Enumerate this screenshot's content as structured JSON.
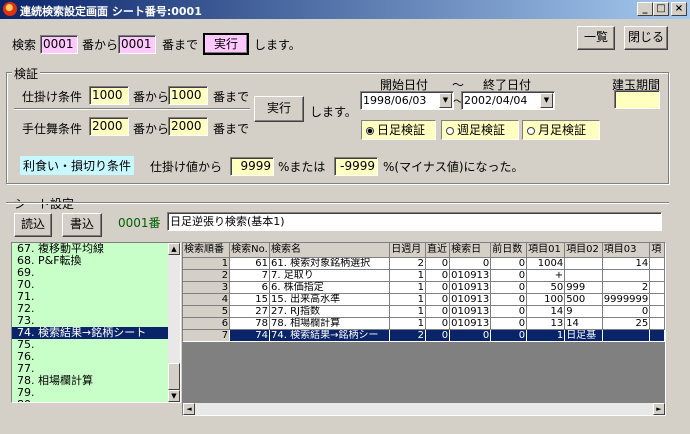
{
  "window": {
    "title": "連続検索設定画面 シート番号:0001",
    "minimize": "_",
    "maximize": "□",
    "close": "×"
  },
  "top": {
    "search_label": "検索",
    "from_value": "0001",
    "from_suffix": "番から",
    "to_value": "0001",
    "to_suffix": "番まで",
    "run": "実行",
    "tail": "します。",
    "list_button": "一覧",
    "close_button": "閉じる"
  },
  "verify": {
    "title": "検証",
    "cond1_label": "仕掛け条件",
    "cond1_from": "1000",
    "cond1_mid": "番から",
    "cond1_to": "1000",
    "cond1_end": "番まで",
    "cond2_label": "手仕舞条件",
    "cond2_from": "2000",
    "cond2_mid": "番から",
    "cond2_to": "2000",
    "cond2_end": "番まで",
    "run": "実行",
    "tail": "します。",
    "start_label": "開始日付",
    "tilde": "～",
    "end_label": "終了日付",
    "start_date": "1998/06/03",
    "end_date": "2002/04/04",
    "period_label": "建玉期間",
    "period_value": "",
    "radio_daily": "日足検証",
    "radio_weekly": "週足検証",
    "radio_monthly": "月足検証",
    "profit_label": "利食い・損切り条件",
    "profit_text1": "仕掛け値から",
    "profit_value": "9999",
    "profit_text2": "%または",
    "loss_value": "-9999",
    "profit_text3": "%(マイナス値)になった。"
  },
  "sheet": {
    "title": "シート設定",
    "load": "読込",
    "write": "書込",
    "number": "0001番",
    "name": "日足逆張り検索(基本1)",
    "list": [
      "67. 複移動平均線",
      "68. P&F転換",
      "69.",
      "70.",
      "71.",
      "72.",
      "73.",
      "74. 検索結果→銘柄シート",
      "75.",
      "76.",
      "77.",
      "78. 相場欄計算",
      "79.",
      "80."
    ],
    "selected_index": 7,
    "columns": [
      "検索順番",
      "検索No.",
      "検索名",
      "日週月",
      "直近",
      "検索日",
      "前日数",
      "項目01",
      "項目02",
      "項目03",
      "項"
    ],
    "rows": [
      [
        "1",
        "61",
        "61. 検索対象銘柄選択",
        "2",
        "0",
        "0",
        "0",
        "1004",
        "",
        "14",
        ""
      ],
      [
        "2",
        "7",
        "7. 足取り",
        "1",
        "0",
        "010913",
        "0",
        "+",
        "",
        "",
        ""
      ],
      [
        "3",
        "6",
        "6. 株価指定",
        "1",
        "0",
        "010913",
        "0",
        "50",
        "999",
        "2",
        ""
      ],
      [
        "4",
        "15",
        "15. 出来高水準",
        "1",
        "0",
        "010913",
        "0",
        "100",
        "500",
        "9999999",
        ""
      ],
      [
        "5",
        "27",
        "27. RJ指数",
        "1",
        "0",
        "010913",
        "0",
        "14",
        "9",
        "0",
        ""
      ],
      [
        "6",
        "78",
        "78. 相場欄計算",
        "1",
        "0",
        "010913",
        "0",
        "13",
        "14",
        "25",
        ""
      ],
      [
        "7",
        "74",
        "74. 検索結果→銘柄シー",
        "2",
        "0",
        "0",
        "0",
        "1",
        "日足基",
        "",
        ""
      ]
    ],
    "selected_row": 6
  }
}
